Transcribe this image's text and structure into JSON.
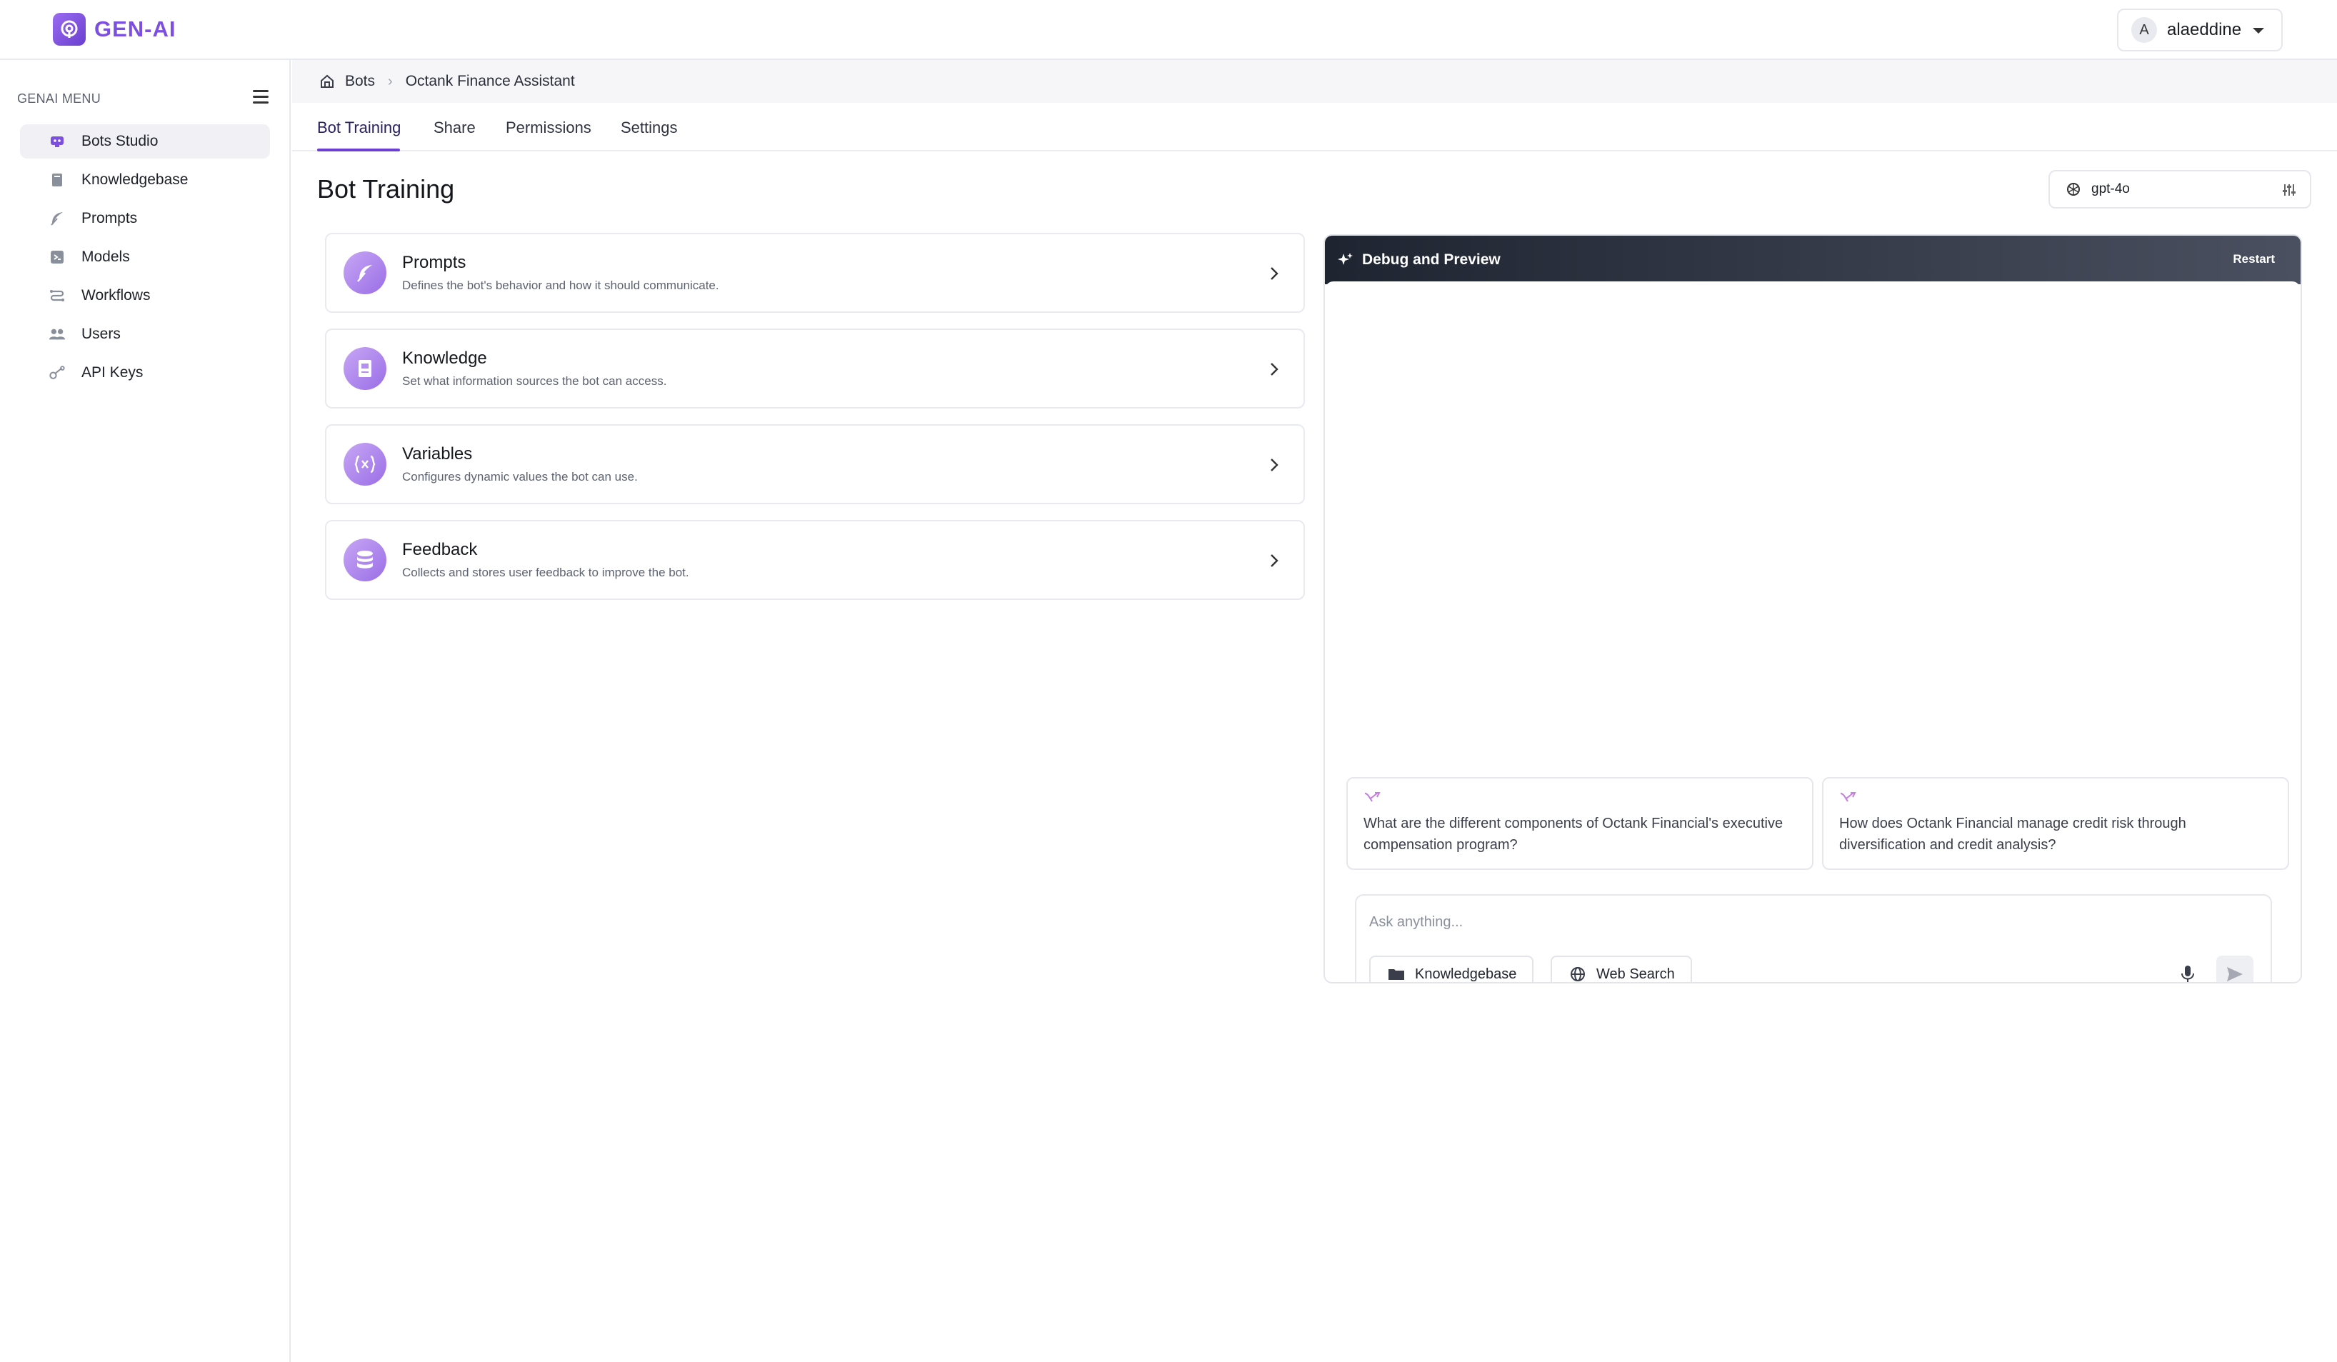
{
  "app": {
    "logo_text": "GEN-AI",
    "brand_color": "#7c4fe0"
  },
  "user": {
    "initial": "A",
    "name": "alaeddine"
  },
  "sidebar": {
    "menu_title": "GENAI MENU",
    "items": [
      {
        "label": "Bots Studio",
        "icon": "bot-icon",
        "active": true
      },
      {
        "label": "Knowledgebase",
        "icon": "book-icon",
        "active": false
      },
      {
        "label": "Prompts",
        "icon": "feather-icon",
        "active": false
      },
      {
        "label": "Models",
        "icon": "model-icon",
        "active": false
      },
      {
        "label": "Workflows",
        "icon": "workflow-icon",
        "active": false
      },
      {
        "label": "Users",
        "icon": "users-icon",
        "active": false
      },
      {
        "label": "API Keys",
        "icon": "key-icon",
        "active": false
      }
    ]
  },
  "breadcrumb": {
    "root": "Bots",
    "current": "Octank Finance Assistant"
  },
  "tabs": [
    {
      "label": "Bot Training",
      "active": true
    },
    {
      "label": "Share",
      "active": false
    },
    {
      "label": "Permissions",
      "active": false
    },
    {
      "label": "Settings",
      "active": false
    }
  ],
  "page": {
    "title": "Bot Training"
  },
  "model_select": {
    "value": "gpt-4o"
  },
  "cards": [
    {
      "title": "Prompts",
      "description": "Defines the bot's behavior and how it should communicate.",
      "icon": "feather-icon"
    },
    {
      "title": "Knowledge",
      "description": "Set what information sources the bot can access.",
      "icon": "book-icon"
    },
    {
      "title": "Variables",
      "description": "Configures dynamic values the bot can use.",
      "icon": "variable-icon"
    },
    {
      "title": "Feedback",
      "description": "Collects and stores user feedback to improve the bot.",
      "icon": "database-icon"
    }
  ],
  "debug": {
    "title": "Debug and Preview",
    "restart_label": "Restart",
    "suggestions": [
      "What are the different components of Octank Financial's executive compensation program?",
      "How does Octank Financial manage credit risk through diversification and credit analysis?"
    ],
    "input_placeholder": "Ask anything...",
    "chips": [
      {
        "label": "Knowledgebase",
        "icon": "folder-icon"
      },
      {
        "label": "Web Search",
        "icon": "globe-icon"
      }
    ]
  }
}
